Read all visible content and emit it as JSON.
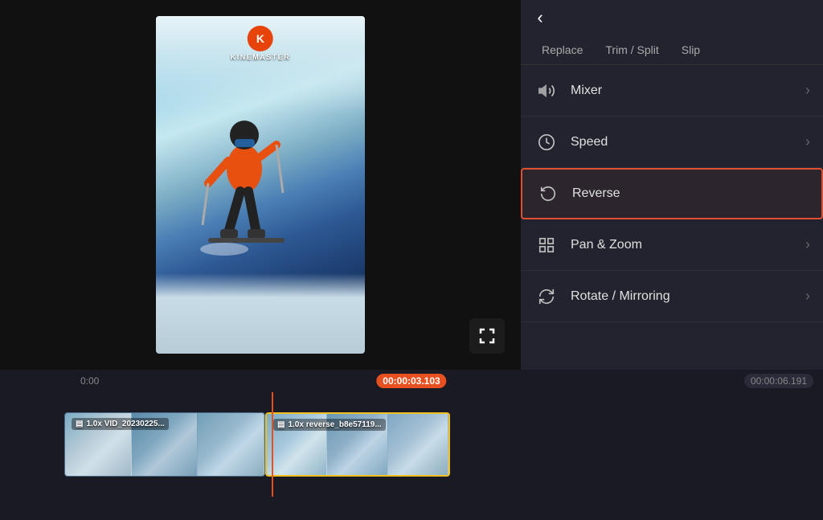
{
  "app": {
    "logo_letter": "K",
    "logo_text": "KINEMASTER"
  },
  "header": {
    "back_label": "‹"
  },
  "tabs": [
    {
      "id": "replace",
      "label": "Replace",
      "active": false
    },
    {
      "id": "trim",
      "label": "Trim / Split",
      "active": false
    },
    {
      "id": "slip",
      "label": "Slip",
      "active": false
    }
  ],
  "menu_items": [
    {
      "id": "mixer",
      "label": "Mixer",
      "has_arrow": true,
      "highlighted": false,
      "icon": "volume-icon"
    },
    {
      "id": "speed",
      "label": "Speed",
      "has_arrow": true,
      "highlighted": false,
      "icon": "speed-icon"
    },
    {
      "id": "reverse",
      "label": "Reverse",
      "has_arrow": false,
      "highlighted": true,
      "icon": "reverse-icon"
    },
    {
      "id": "pan-zoom",
      "label": "Pan & Zoom",
      "has_arrow": true,
      "highlighted": false,
      "icon": "pan-zoom-icon"
    },
    {
      "id": "rotate",
      "label": "Rotate / Mirroring",
      "has_arrow": true,
      "highlighted": false,
      "icon": "rotate-icon"
    }
  ],
  "timeline": {
    "time_start": "0:00",
    "time_current": "00:00:03.103",
    "time_end": "00:00:06.191",
    "clip1_label": "1.0x VID_20230225...",
    "clip2_label": "1.0x reverse_b8e57119..."
  },
  "icons": {
    "back": "‹",
    "chevron_right": "›",
    "fullscreen": "⛶"
  },
  "colors": {
    "accent": "#e85020",
    "highlight_border": "#e05030",
    "clip_border": "#f0c020",
    "bg_panel": "#23232f",
    "bg_timeline": "#1a1a24"
  }
}
